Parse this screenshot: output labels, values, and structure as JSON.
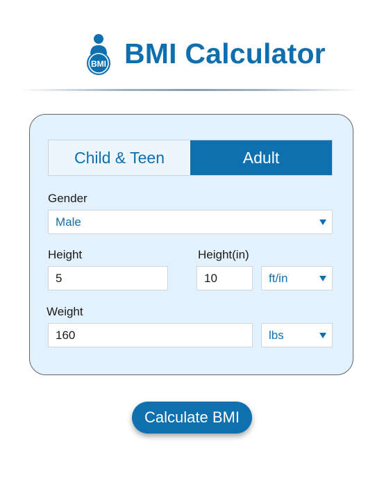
{
  "app": {
    "title": "BMI Calculator",
    "logo_text": "BMI"
  },
  "tabs": [
    {
      "label": "Child & Teen",
      "active": false
    },
    {
      "label": "Adult",
      "active": true
    }
  ],
  "form": {
    "gender": {
      "label": "Gender",
      "value": "Male"
    },
    "height": {
      "label": "Height",
      "value": "5"
    },
    "height_in": {
      "label": "Height(in)",
      "value": "10"
    },
    "height_unit": {
      "value": "ft/in"
    },
    "weight": {
      "label": "Weight",
      "value": "160"
    },
    "weight_unit": {
      "value": "lbs"
    }
  },
  "calculate_label": "Calculate BMI",
  "colors": {
    "accent": "#0f70b0",
    "panel_bg": "#e3f1fc",
    "title": "#0f6fae"
  }
}
